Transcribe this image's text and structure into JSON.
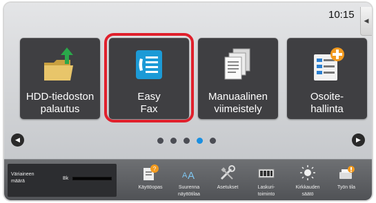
{
  "status": {
    "time": "10:15"
  },
  "side_tab_icon": "speaker-icon",
  "tiles": [
    {
      "label": "HDD-tiedoston\npalautus",
      "icon": "folder-upload-icon"
    },
    {
      "label": "Easy\nFax",
      "icon": "fax-icon"
    },
    {
      "label": "Manuaalinen\nviimeistely",
      "icon": "documents-icon"
    },
    {
      "label": "Osoite-\nhallinta",
      "icon": "address-book-add-icon"
    }
  ],
  "pager": {
    "total": 5,
    "active_index": 3
  },
  "toner": {
    "title": "Väriaineen\nmäärä",
    "color_label": "Bk",
    "level": 1.0
  },
  "bottom_items": [
    {
      "label": "Käyttöopas",
      "icon": "manual-icon"
    },
    {
      "label": "Suurenna\nnäyttötilaa",
      "icon": "enlarge-text-icon"
    },
    {
      "label": "Asetukset",
      "icon": "settings-tools-icon"
    },
    {
      "label": "Laskuri-\ntoiminto",
      "icon": "counter-icon"
    },
    {
      "label": "Kirkkauden\nsäätö",
      "icon": "brightness-icon"
    },
    {
      "label": "Työn tila",
      "icon": "job-status-icon"
    }
  ],
  "colors": {
    "highlight": "#e0202c",
    "active_dot": "#1a8fe0",
    "tile_bg": "#3f3f42"
  }
}
